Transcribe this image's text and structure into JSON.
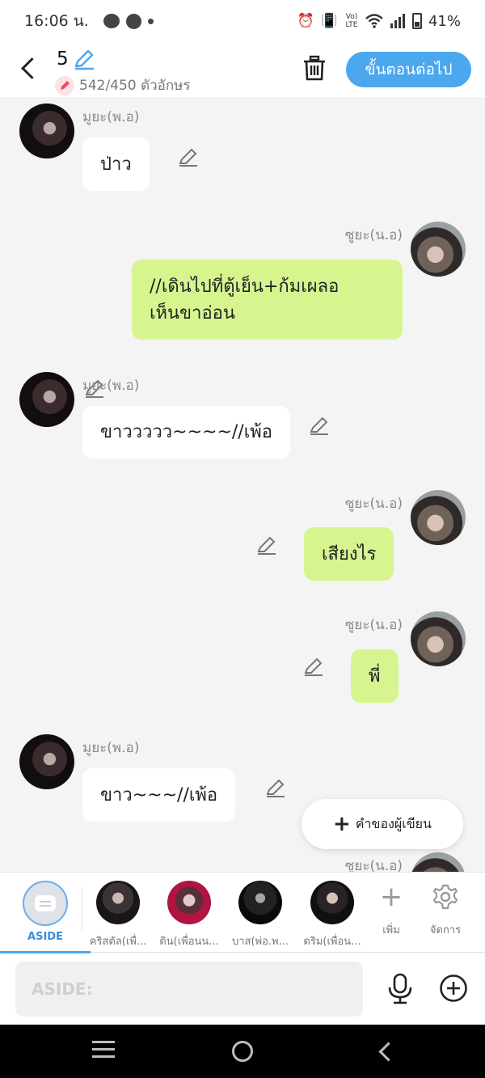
{
  "status_bar": {
    "time": "16:06 น.",
    "battery": "41%",
    "network_label": "Vo) LTE"
  },
  "header": {
    "episode_number": "5",
    "char_count": "542/450 ตัวอักษร",
    "next_button": "ขั้นตอนต่อไป"
  },
  "messages": [
    {
      "side": "left",
      "name": "มูยะ(พ.อ)",
      "text": "ป่าว",
      "color": "#ffffff"
    },
    {
      "side": "right",
      "name": "ซูยะ(น.อ)",
      "text_lines": [
        "//เดินไปที่ตู้เย็น+ก้มเผลอ",
        "เห็นขาอ่อน"
      ],
      "color": "#d6f58f"
    },
    {
      "side": "left",
      "name": "มูยะ(พ.อ)",
      "text": "ขาววววว~~~~//เพ้อ",
      "color": "#ffffff"
    },
    {
      "side": "right",
      "name": "ซูยะ(น.อ)",
      "text": "เสียงไร",
      "color": "#d6f58f"
    },
    {
      "side": "right",
      "name": "ซูยะ(น.อ)",
      "text": "พี่",
      "color": "#d6f58f"
    },
    {
      "side": "left",
      "name": "มูยะ(พ.อ)",
      "text": "ขาว~~~//เพ้อ",
      "color": "#ffffff"
    },
    {
      "side": "right",
      "name": "ซูยะ(น.อ)",
      "text": ""
    }
  ],
  "fab": {
    "label": "คำของผู้เขียน"
  },
  "tray": {
    "aside_label": "ASIDE",
    "characters": [
      "คริสตัล(เพื่...",
      "ติน(เพื่อนน...",
      "บาส(พ่อ.พ...",
      "ดริม(เพื่อน..."
    ],
    "add_label": "เพิ่ม",
    "manage_label": "จัดการ"
  },
  "input": {
    "placeholder": "ASIDE:"
  },
  "colors": {
    "accent": "#4ba7ee",
    "bubble_right": "#d6f58f",
    "bubble_left": "#ffffff",
    "background": "#f4f4f4"
  }
}
